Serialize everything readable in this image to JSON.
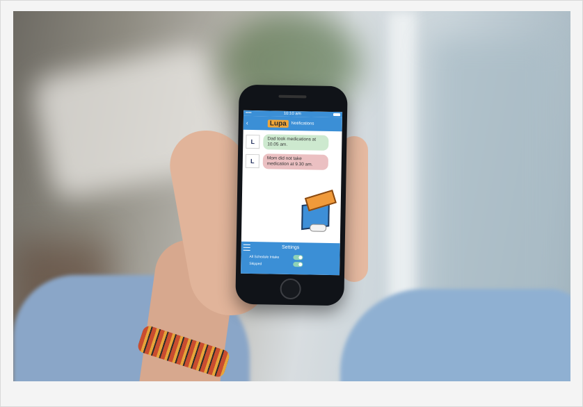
{
  "status_bar": {
    "carrier": "••••",
    "time": "10:10 am"
  },
  "nav": {
    "back_icon": "chevron-left-icon",
    "logo": "Lupa",
    "title": "Notifications"
  },
  "messages": [
    {
      "avatar": "L",
      "text": "Dad took medications at 10.05 am.",
      "color": "#cde9cf"
    },
    {
      "avatar": "L",
      "text": "Mom did not take medication at 9.30 am.",
      "color": "#ebc0c2"
    }
  ],
  "settings": {
    "title": "Settings",
    "rows": [
      {
        "label": "All Schedule Intake",
        "on": true
      },
      {
        "label": "Skipped",
        "on": true
      }
    ]
  },
  "colors": {
    "app_blue": "#3b8fd6",
    "toggle_on": "#8fd3b6",
    "logo_orange": "#f0a638"
  }
}
